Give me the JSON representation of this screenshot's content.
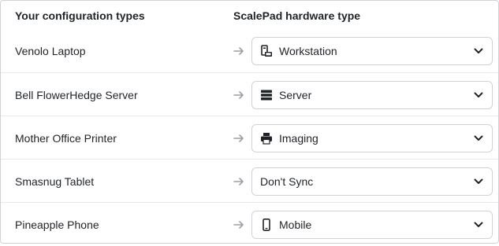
{
  "header": {
    "left_title": "Your configuration types",
    "right_title": "ScalePad hardware type"
  },
  "rows": [
    {
      "name": "Venolo Laptop",
      "selected": "Workstation",
      "icon": "workstation-icon"
    },
    {
      "name": "Bell FlowerHedge Server",
      "selected": "Server",
      "icon": "server-icon"
    },
    {
      "name": "Mother Office Printer",
      "selected": "Imaging",
      "icon": "printer-icon"
    },
    {
      "name": "Smasnug Tablet",
      "selected": "Don't Sync",
      "icon": ""
    },
    {
      "name": "Pineapple Phone",
      "selected": "Mobile",
      "icon": "mobile-icon"
    }
  ],
  "colors": {
    "border": "#cfd3d8",
    "divider": "#e6e8eb",
    "arrow": "#9aa0a6",
    "text": "#1f2328"
  }
}
